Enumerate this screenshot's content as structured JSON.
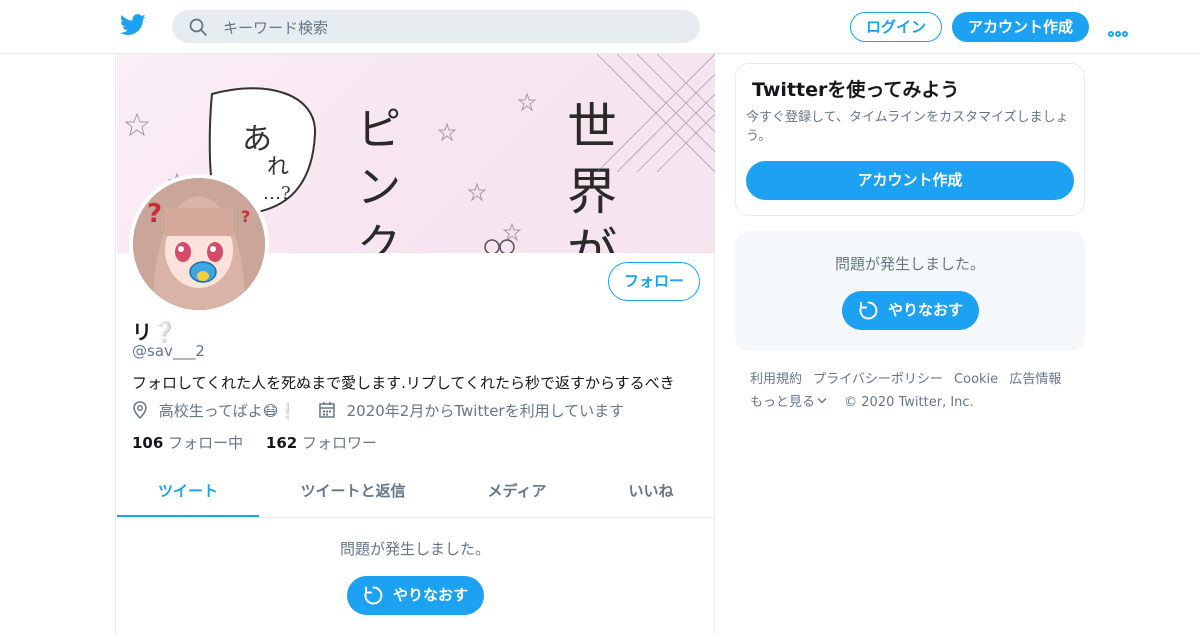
{
  "header": {
    "logo_icon": "twitter-bird-icon",
    "search_placeholder": "キーワード検索",
    "login_label": "ログイン",
    "signup_label": "アカウント作成",
    "more_icon": "more-dots-icon"
  },
  "profile": {
    "name": "リ",
    "name_emoji": "❔",
    "handle": "@sav___2",
    "bio": "フォロしてくれた人を死ぬまで愛します.リプしてくれたら秒で返すからするべき",
    "location": "高校生ってばよ😷❕",
    "joined": "2020年2月からTwitterを利用しています",
    "following_count": "106",
    "following_label": "フォロー中",
    "followers_count": "162",
    "followers_label": "フォロワー",
    "follow_button": "フォロー"
  },
  "tabs": [
    {
      "label": "ツイート",
      "active": true
    },
    {
      "label": "ツイートと返信",
      "active": false
    },
    {
      "label": "メディア",
      "active": false
    },
    {
      "label": "いいね",
      "active": false
    }
  ],
  "timeline": {
    "error_text": "問題が発生しました。",
    "retry_label": "やりなおす"
  },
  "sidebar": {
    "signup_card": {
      "title": "Twitterを使ってみよう",
      "subtitle": "今すぐ登録して、タイムラインをカスタマイズしましょう。",
      "button": "アカウント作成"
    },
    "error_panel": {
      "error_text": "問題が発生しました。",
      "retry_label": "やりなおす"
    },
    "footer": {
      "links": [
        "利用規約",
        "プライバシーポリシー",
        "Cookie",
        "広告情報"
      ],
      "more": "もっと見る",
      "copyright": "© 2020 Twitter, Inc."
    }
  },
  "colors": {
    "accent": "#1da1f2",
    "text_secondary": "#657786",
    "border": "#e6ecf0"
  }
}
